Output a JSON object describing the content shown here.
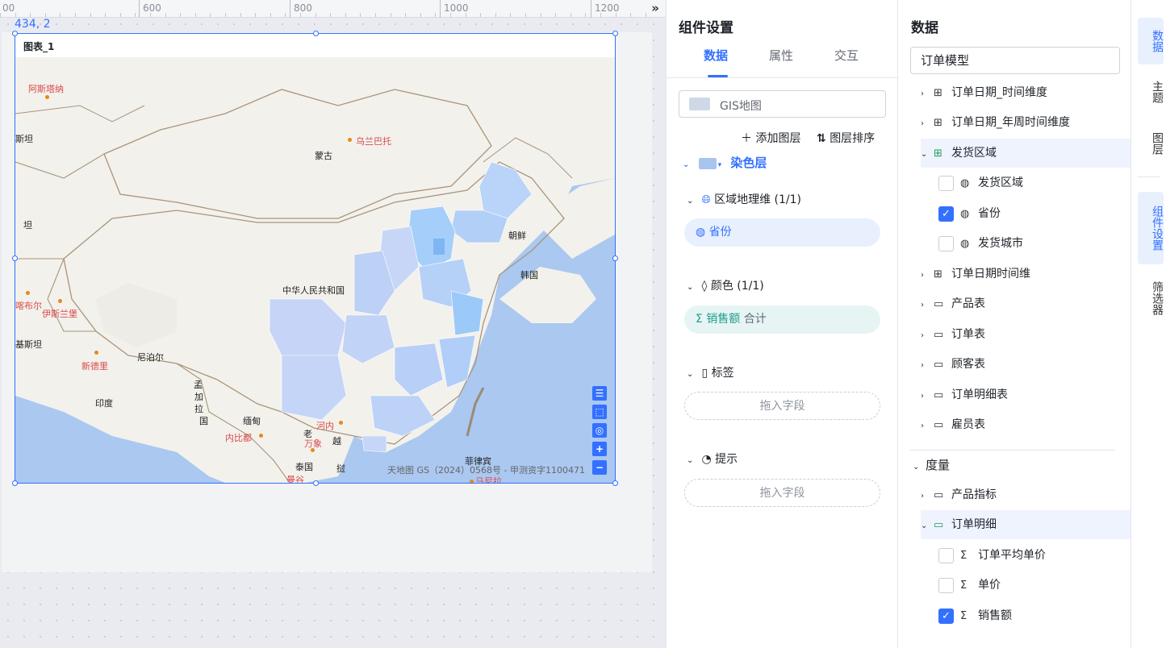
{
  "ruler": {
    "ticks": [
      "00",
      "600",
      "800",
      "1000",
      "1200"
    ],
    "collapse_icon": "double-chevron-right-icon"
  },
  "canvas": {
    "coord": "434, 2"
  },
  "chart": {
    "title": "图表_1",
    "map": {
      "labels": [
        "阿斯塔纳",
        "乌兰巴托",
        "蒙古",
        "斯坦",
        "坦",
        "中华人民共和国",
        "朝鲜",
        "韩国",
        "喀布尔",
        "伊斯兰堡",
        "基斯坦",
        "新德里",
        "尼泊尔",
        "印度",
        "孟",
        "加",
        "拉",
        "国",
        "缅甸",
        "老",
        "越",
        "河内",
        "内比都",
        "万象",
        "泰国",
        "挝",
        "曼谷",
        "菲律宾",
        "马尼拉"
      ],
      "attribution": "天地图 GS（2024）0568号 - 甲测资字1100471",
      "tools": [
        "list-icon",
        "frame-icon",
        "locate-icon",
        "+",
        "−"
      ]
    }
  },
  "settings": {
    "title": "组件设置",
    "tabs": [
      "数据",
      "属性",
      "交互"
    ],
    "active_tab": "数据",
    "map_type": "GIS地图",
    "add_layer": "添加图层",
    "sort_layer": "图层排序",
    "layer_name": "染色层",
    "geo_section": "区域地理维 (1/1)",
    "geo_field": "省份",
    "color_section": "颜色 (1/1)",
    "color_field": "销售额",
    "color_agg": "合计",
    "label_section": "标签",
    "label_placeholder": "拖入字段",
    "tooltip_section": "提示",
    "tooltip_placeholder": "拖入字段"
  },
  "data": {
    "title": "数据",
    "model": "订单模型",
    "tree": [
      {
        "label": "订单日期_时间维度",
        "type": "hierarchy"
      },
      {
        "label": "订单日期_年周时间维度",
        "type": "hierarchy"
      },
      {
        "label": "发货区域",
        "type": "hierarchy-checked",
        "expanded": true
      },
      {
        "label": "发货区域",
        "type": "geo",
        "checked": false
      },
      {
        "label": "省份",
        "type": "geo",
        "checked": true
      },
      {
        "label": "发货城市",
        "type": "geo",
        "checked": false
      },
      {
        "label": "订单日期时间维",
        "type": "hierarchy"
      },
      {
        "label": "产品表",
        "type": "folder"
      },
      {
        "label": "订单表",
        "type": "folder"
      },
      {
        "label": "顾客表",
        "type": "folder"
      },
      {
        "label": "订单明细表",
        "type": "folder"
      },
      {
        "label": "雇员表",
        "type": "folder"
      }
    ],
    "measure_header": "度量",
    "measures": [
      {
        "label": "产品指标",
        "type": "folder"
      },
      {
        "label": "订单明细",
        "type": "folder-checked",
        "expanded": true
      },
      {
        "label": "订单平均单价",
        "type": "sum",
        "checked": false
      },
      {
        "label": "单价",
        "type": "sum",
        "checked": false
      },
      {
        "label": "销售额",
        "type": "sum",
        "checked": true
      }
    ]
  },
  "rail": [
    "数据",
    "主题",
    "图层",
    "组件设置",
    "筛选器"
  ],
  "rail_active": "组件设置"
}
